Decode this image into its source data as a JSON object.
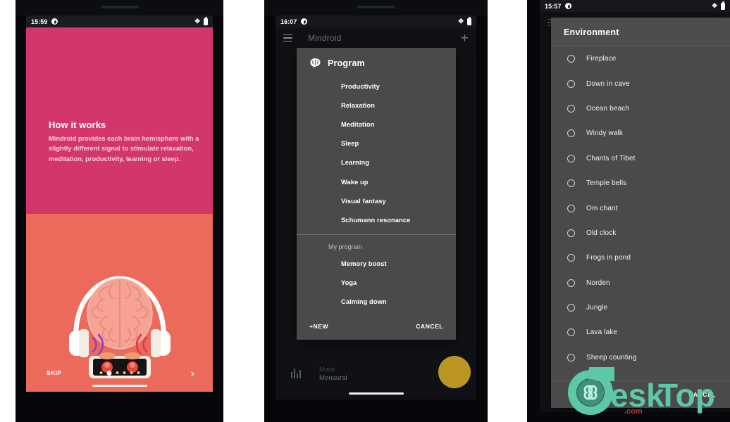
{
  "colors": {
    "pink": "#d2366a",
    "coral": "#ec6a5b",
    "dialog_bg": "#4a4a4a",
    "fab": "#c9a227",
    "watermark": "#5cc8a8"
  },
  "phone1": {
    "status": {
      "time": "15:59",
      "right_icons": [
        "bluetooth-icon",
        "battery-icon"
      ]
    },
    "onboarding": {
      "title": "How it works",
      "body": "Mindroid provides each brain hemisphere with a slightly different signal to stimulate relaxation, meditation, productivity, learning or sleep.",
      "skip_label": "SKIP",
      "next_label": "›",
      "dot_count": 6,
      "active_dot": 2
    }
  },
  "phone2": {
    "status": {
      "time": "16:07"
    },
    "appbar": {
      "title": "Mindroid",
      "menu_icon": "hamburger-icon",
      "add_icon": "plus-icon"
    },
    "background": {
      "mode_label": "Mode",
      "mode_value": "Monaural"
    },
    "dialog": {
      "title": "Program",
      "icon": "brain-icon",
      "items": [
        "Productivity",
        "Relaxation",
        "Meditation",
        "Sleep",
        "Learning",
        "Wake up",
        "Visual fantasy",
        "Schumann resonance"
      ],
      "section_label": "My program",
      "custom_items": [
        "Memory boost",
        "Yoga",
        "Calming down"
      ],
      "new_label": "+NEW",
      "cancel_label": "CANCEL"
    }
  },
  "phone3": {
    "status": {
      "time": "15:57"
    },
    "dialog": {
      "title": "Environment",
      "items": [
        "Fireplace",
        "Down in cave",
        "Ocean beach",
        "Windy walk",
        "Chants of Tibet",
        "Temple bells",
        "Om chant",
        "Old clock",
        "Frogs in pond",
        "Norden",
        "Jungle",
        "Lava lake",
        "Sheep counting"
      ],
      "cancel_label": "CANCEL"
    }
  },
  "watermark": {
    "text_a": "esk",
    "text_b": "Top",
    "sub": ".com"
  }
}
